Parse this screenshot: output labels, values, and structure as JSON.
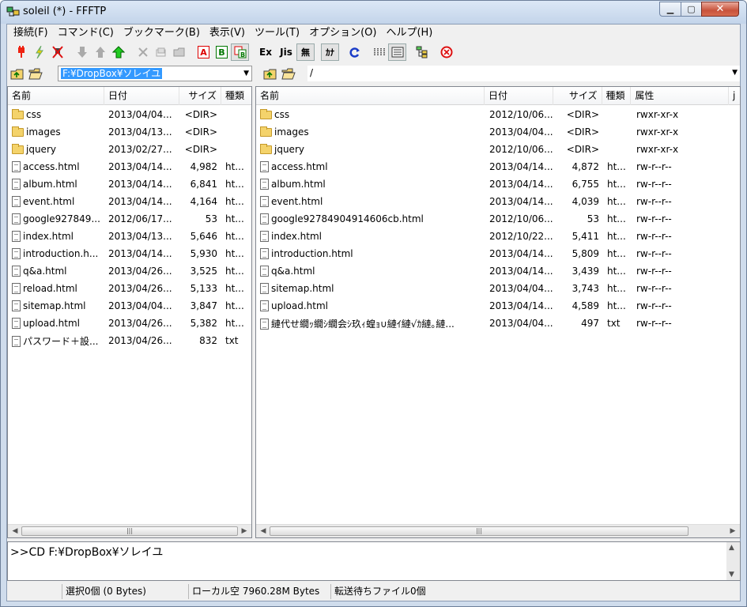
{
  "window": {
    "title": "soleil (*) - FFFTP"
  },
  "menu": [
    "接続(F)",
    "コマンド(C)",
    "ブックマーク(B)",
    "表示(V)",
    "ツール(T)",
    "オプション(O)",
    "ヘルプ(H)"
  ],
  "toolbar": {
    "text_a": "A",
    "text_b": "B",
    "text_ex": "Ex",
    "text_jis": "Jis",
    "text_mu": "無",
    "text_kana": "ｶﾅ"
  },
  "local": {
    "path": "F:¥DropBox¥ソレイユ",
    "headers": {
      "name": "名前",
      "date": "日付",
      "size": "サイズ",
      "type": "種類"
    },
    "files": [
      {
        "name": "css",
        "date": "2013/04/04...",
        "size": "<DIR>",
        "type": "",
        "icon": "folder"
      },
      {
        "name": "images",
        "date": "2013/04/13...",
        "size": "<DIR>",
        "type": "",
        "icon": "folder"
      },
      {
        "name": "jquery",
        "date": "2013/02/27...",
        "size": "<DIR>",
        "type": "",
        "icon": "folder"
      },
      {
        "name": "access.html",
        "date": "2013/04/14...",
        "size": "4,982",
        "type": "ht...",
        "icon": "file"
      },
      {
        "name": "album.html",
        "date": "2013/04/14...",
        "size": "6,841",
        "type": "ht...",
        "icon": "file"
      },
      {
        "name": "event.html",
        "date": "2013/04/14...",
        "size": "4,164",
        "type": "ht...",
        "icon": "file"
      },
      {
        "name": "google927849...",
        "date": "2012/06/17...",
        "size": "53",
        "type": "ht...",
        "icon": "file"
      },
      {
        "name": "index.html",
        "date": "2013/04/13...",
        "size": "5,646",
        "type": "ht...",
        "icon": "file"
      },
      {
        "name": "introduction.h...",
        "date": "2013/04/14...",
        "size": "5,930",
        "type": "ht...",
        "icon": "file"
      },
      {
        "name": "q&a.html",
        "date": "2013/04/26...",
        "size": "3,525",
        "type": "ht...",
        "icon": "file"
      },
      {
        "name": "reload.html",
        "date": "2013/04/26...",
        "size": "5,133",
        "type": "ht...",
        "icon": "file"
      },
      {
        "name": "sitemap.html",
        "date": "2013/04/04...",
        "size": "3,847",
        "type": "ht...",
        "icon": "file"
      },
      {
        "name": "upload.html",
        "date": "2013/04/26...",
        "size": "5,382",
        "type": "ht...",
        "icon": "file"
      },
      {
        "name": "パスワード＋設...",
        "date": "2013/04/26...",
        "size": "832",
        "type": "txt",
        "icon": "file"
      }
    ]
  },
  "remote": {
    "path": "/",
    "headers": {
      "name": "名前",
      "date": "日付",
      "size": "サイズ",
      "type": "種類",
      "attr": "属性",
      "extra": "j"
    },
    "files": [
      {
        "name": "css",
        "date": "2012/10/06...",
        "size": "<DIR>",
        "type": "",
        "attr": "rwxr-xr-x",
        "icon": "folder"
      },
      {
        "name": "images",
        "date": "2013/04/04...",
        "size": "<DIR>",
        "type": "",
        "attr": "rwxr-xr-x",
        "icon": "folder"
      },
      {
        "name": "jquery",
        "date": "2012/10/06...",
        "size": "<DIR>",
        "type": "",
        "attr": "rwxr-xr-x",
        "icon": "folder"
      },
      {
        "name": "access.html",
        "date": "2013/04/14...",
        "size": "4,872",
        "type": "ht...",
        "attr": "rw-r--r--",
        "icon": "file"
      },
      {
        "name": "album.html",
        "date": "2013/04/14...",
        "size": "6,755",
        "type": "ht...",
        "attr": "rw-r--r--",
        "icon": "file"
      },
      {
        "name": "event.html",
        "date": "2013/04/14...",
        "size": "4,039",
        "type": "ht...",
        "attr": "rw-r--r--",
        "icon": "file"
      },
      {
        "name": "google92784904914606cb.html",
        "date": "2012/10/06...",
        "size": "53",
        "type": "ht...",
        "attr": "rw-r--r--",
        "icon": "file"
      },
      {
        "name": "index.html",
        "date": "2012/10/22...",
        "size": "5,411",
        "type": "ht...",
        "attr": "rw-r--r--",
        "icon": "file"
      },
      {
        "name": "introduction.html",
        "date": "2013/04/14...",
        "size": "5,809",
        "type": "ht...",
        "attr": "rw-r--r--",
        "icon": "file"
      },
      {
        "name": "q&a.html",
        "date": "2013/04/14...",
        "size": "3,439",
        "type": "ht...",
        "attr": "rw-r--r--",
        "icon": "file"
      },
      {
        "name": "sitemap.html",
        "date": "2013/04/04...",
        "size": "3,743",
        "type": "ht...",
        "attr": "rw-r--r--",
        "icon": "file"
      },
      {
        "name": "upload.html",
        "date": "2013/04/14...",
        "size": "4,589",
        "type": "ht...",
        "attr": "rw-r--r--",
        "icon": "file"
      },
      {
        "name": "縺代せ繝ｯ繝ｼ繝会ｼ玖ｨ蝗ｮ∪縺ｲ縺√ｶ縺｡縺...",
        "date": "2013/04/04...",
        "size": "497",
        "type": "txt",
        "attr": "rw-r--r--",
        "icon": "file"
      }
    ]
  },
  "log": ">>CD F:¥DropBox¥ソレイユ",
  "status": {
    "selected": "選択0個 (0 Bytes)",
    "local_free": "ローカル空 7960.28M Bytes",
    "queue": "転送待ちファイル0個"
  }
}
